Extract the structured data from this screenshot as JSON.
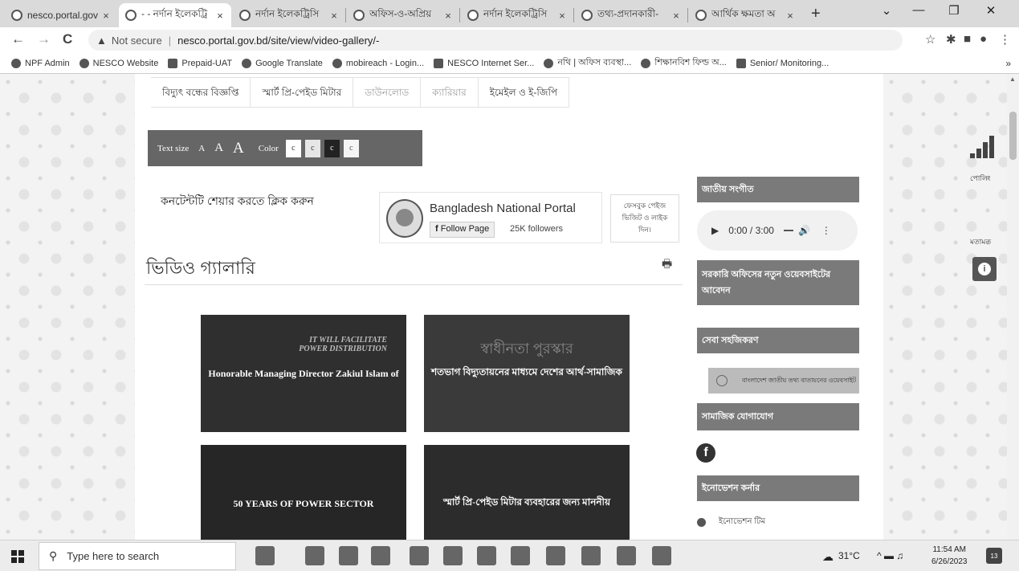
{
  "browser": {
    "tabs": [
      {
        "title": "nesco.portal.gov",
        "active": false
      },
      {
        "title": "- - নর্দান ইলেকট্রি",
        "active": true
      },
      {
        "title": "নর্দান ইলেকট্রিসি",
        "active": false
      },
      {
        "title": "অফিস-ও-অপ্রিয়",
        "active": false
      },
      {
        "title": "নর্দান ইলেকট্রিসি",
        "active": false
      },
      {
        "title": "তথ্য-প্রদানকারী-",
        "active": false
      },
      {
        "title": "আর্থিক ক্ষমতা অ",
        "active": false
      }
    ],
    "tab_close_glyph": "×",
    "new_tab_glyph": "+",
    "window_controls": {
      "dropdown": "⌄",
      "minimize": "—",
      "maximize": "❐",
      "close": "✕"
    },
    "nav": {
      "back": "←",
      "forward": "→",
      "reload": "C"
    },
    "address": {
      "security_icon": "▲",
      "security_label": "Not secure",
      "url": "nesco.portal.gov.bd/site/view/video-gallery/-"
    },
    "toolbar_icons": {
      "share": "⇪",
      "star": "☆",
      "extensions": "✱",
      "sidepanel": "■",
      "profile": "●",
      "menu": "⋮"
    },
    "bookmarks": [
      "NPF Admin",
      "NESCO Website",
      "Prepaid-UAT",
      "Google Translate",
      "mobireach - Login...",
      "NESCO Internet Ser...",
      "নথি | অফিস ব্যবস্থা...",
      "শিক্ষানবিশ ফিল্ড অ...",
      "Senior/ Monitoring..."
    ],
    "bookmarks_overflow": "»"
  },
  "page": {
    "menu_items": [
      {
        "label": "বিদ্যুৎ বন্ধের বিজ্ঞপ্তি",
        "dim": false
      },
      {
        "label": "স্মার্ট প্রি-পেইড মিটার",
        "dim": false
      },
      {
        "label": "ডাউনলোড",
        "dim": true
      },
      {
        "label": "ক্যারিয়ার",
        "dim": true
      },
      {
        "label": "ইমেইল ও ই-জিপি",
        "dim": false
      }
    ],
    "accessibility": {
      "text_size_label": "Text size",
      "size_letters": [
        "A",
        "A",
        "A"
      ],
      "color_label": "Color",
      "color_boxes": [
        {
          "letter": "c",
          "bg": "#ffffff",
          "fg": "#333333"
        },
        {
          "letter": "c",
          "bg": "#e6e6e6",
          "fg": "#333333"
        },
        {
          "letter": "c",
          "bg": "#222222",
          "fg": "#ffffff"
        },
        {
          "letter": "c",
          "bg": "#f5f5f5",
          "fg": "#555555"
        }
      ]
    },
    "share_text": "কনটেন্টটি শেয়ার করতে ক্লিক করুন",
    "fb_widget": {
      "page_name": "Bangladesh National Portal",
      "follow_label": "Follow Page",
      "followers": "25K followers",
      "fb_glyph": "f"
    },
    "visit_text": [
      "ফেসবুক পেইজ",
      "ভিজিট ও লাইক",
      "দিন।"
    ],
    "gallery_title": "ভিডিও গ্যালারি",
    "print_icon": "🖶",
    "videos": [
      {
        "caption": "Honorable Managing Director Zakiul Islam of",
        "overlay": "IT WILL FACILITATE POWER DISTRIBUTION"
      },
      {
        "caption": "শতভাগ বিদ্যুতায়নের মাধ্যমে দেশের আর্থ-সামাজিক",
        "overlay": "স্বাধীনতা পুরস্কার"
      },
      {
        "caption": "50 YEARS OF POWER SECTOR",
        "overlay": ""
      },
      {
        "caption": "স্মার্ট প্রি-পেইড মিটার ব্যবহারের জন্য মাননীয়",
        "overlay": ""
      }
    ]
  },
  "sidebar": {
    "anthem_title": "জাতীয় সংগীত",
    "audio": {
      "play_glyph": "▶",
      "time": "0:00 / 3:00",
      "volume_glyph": "🔊",
      "more_glyph": "⋮"
    },
    "new_site_title": "সরকারি অফিসের নতুন ওয়েবসাইটের আবেদন",
    "seba_title": "সেবা সহজিকরণ",
    "seba_banner_text": "বাংলাদেশ জাতীয় তথ্য বাতায়নের ওয়েবসাইট",
    "social_title": "সামাজিক যোগাযোগ",
    "social_fb_glyph": "f",
    "innovation_title": "ইনোভেশন কর্নার",
    "innovation_item": "ইনোভেশন টিম"
  },
  "floating": {
    "poll_label": "পোলিং",
    "opinion_label": "মতামত",
    "a11y_glyph": "i"
  },
  "taskbar": {
    "search_placeholder": "Type here to search",
    "search_icon": "⚲",
    "apps": [
      "",
      "",
      "",
      "",
      "",
      "",
      "",
      "",
      "",
      "",
      "",
      ""
    ],
    "weather": "31°C",
    "tray_icons": "^ ▬ ♫",
    "time": "11:54 AM",
    "date": "6/26/2023",
    "notification_count": "13"
  }
}
